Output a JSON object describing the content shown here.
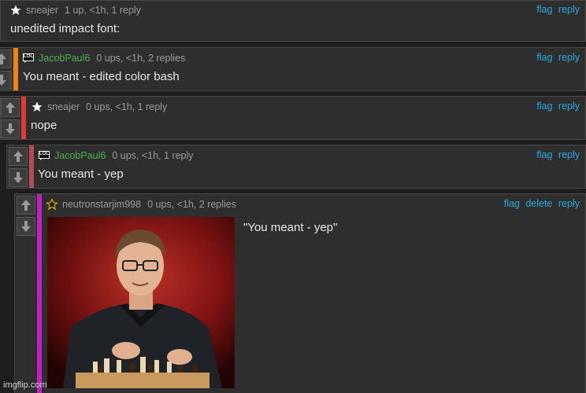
{
  "comments": [
    {
      "username": "sneajer",
      "meta": "1 up, <1h, 1 reply",
      "text": "unedited impact font:",
      "actions": [
        "flag",
        "reply"
      ],
      "badge_icon": "star-icon",
      "bar_color": "#555555"
    },
    {
      "username": "JacobPaul6",
      "meta": "0 ups, <1h, 2 replies",
      "text": "You meant - edited color bash",
      "actions": [
        "flag",
        "reply"
      ],
      "badge_icon": "lol-badge-icon",
      "badge_text": "LOL",
      "bar_color": "#f0820f"
    },
    {
      "username": "sneajer",
      "meta": "0 ups, <1h, 1 reply",
      "text": "nope",
      "actions": [
        "flag",
        "reply"
      ],
      "badge_icon": "star-icon",
      "bar_color": "#e53935"
    },
    {
      "username": "JacobPaul6",
      "meta": "0 ups, <1h, 1 reply",
      "text": "You meant - yep",
      "actions": [
        "flag",
        "reply"
      ],
      "badge_icon": "lol-badge-icon",
      "badge_text": "LOL",
      "bar_color": "#b84a58"
    },
    {
      "username": "neutronstarjim998",
      "meta": "0 ups, <1h, 2 replies",
      "text": "\"You meant - yep\"",
      "actions": [
        "flag",
        "delete",
        "reply"
      ],
      "badge_icon": "gold-star-icon",
      "bar_color": "#c41fc4",
      "image_icon": "chess-player-photo"
    }
  ],
  "watermark": "imgflip.com",
  "colors": {
    "background": "#1e1e1e",
    "card": "#2e2e2e",
    "link": "#27a9e1",
    "green_username": "#4caf50"
  }
}
